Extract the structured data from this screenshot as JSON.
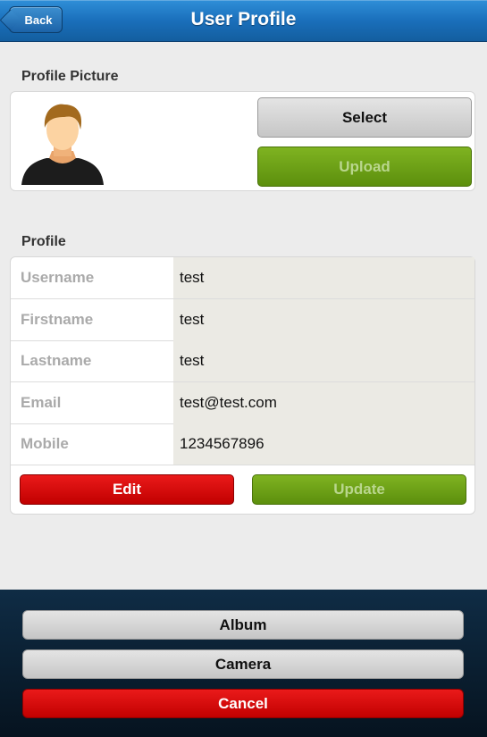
{
  "header": {
    "back_label": "Back",
    "title": "User Profile"
  },
  "picture_section": {
    "title": "Profile Picture",
    "select_label": "Select",
    "upload_label": "Upload"
  },
  "profile_section": {
    "title": "Profile",
    "rows": [
      {
        "label": "Username",
        "value": "test"
      },
      {
        "label": "Firstname",
        "value": "test"
      },
      {
        "label": "Lastname",
        "value": "test"
      },
      {
        "label": "Email",
        "value": "test@test.com"
      },
      {
        "label": "Mobile",
        "value": "1234567896"
      }
    ],
    "edit_label": "Edit",
    "update_label": "Update"
  },
  "action_sheet": {
    "album_label": "Album",
    "camera_label": "Camera",
    "cancel_label": "Cancel"
  },
  "colors": {
    "header_blue": "#1a6fbb",
    "green": "#6aa314",
    "red": "#d40000"
  },
  "icons": {
    "avatar": "user-avatar-icon"
  }
}
